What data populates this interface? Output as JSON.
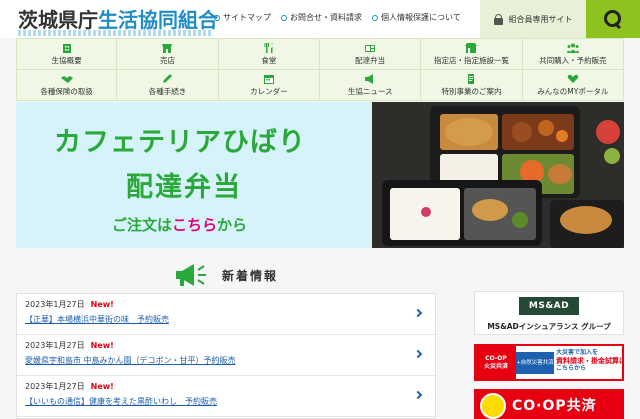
{
  "header": {
    "logo_main": "茨城県庁",
    "logo_accent": "生活協同組合",
    "links": [
      "サイトマップ",
      "お問合せ・資料請求",
      "個人情報保護について"
    ],
    "member_site": "組合員専用サイト"
  },
  "nav": {
    "items": [
      {
        "label": "生協概要",
        "icon": "building-icon"
      },
      {
        "label": "売店",
        "icon": "shop-icon"
      },
      {
        "label": "食堂",
        "icon": "cutlery-icon"
      },
      {
        "label": "配達弁当",
        "icon": "bento-icon"
      },
      {
        "label": "指定店・指定施設一覧",
        "icon": "store-icon"
      },
      {
        "label": "共同購入・予約販売",
        "icon": "people-icon"
      },
      {
        "label": "各種保険の取扱",
        "icon": "handshake-icon"
      },
      {
        "label": "各種手続き",
        "icon": "pen-icon"
      },
      {
        "label": "カレンダー",
        "icon": "calendar-icon"
      },
      {
        "label": "生協ニュース",
        "icon": "megaphone-icon"
      },
      {
        "label": "特別事業のご案内",
        "icon": "document-icon"
      },
      {
        "label": "みんなのMYポータル",
        "icon": "heart-icon"
      }
    ]
  },
  "hero": {
    "title": "カフェテリアひばり",
    "subtitle": "配達弁当",
    "order_prefix": "ご注文は",
    "order_highlight": "こちら",
    "order_suffix": "から"
  },
  "news": {
    "title": "新着情報",
    "new_label": "New!",
    "items": [
      {
        "date": "2023年1月27日",
        "text": "【正華】本場横浜中華街の味　予約販売"
      },
      {
        "date": "2023年1月27日",
        "text": "愛媛県宇和島市 中島みかん園（デコポン・甘平）予約販売"
      },
      {
        "date": "2023年1月27日",
        "text": "【いいもの通信】健康を考えた黒酢いわし　予約販売"
      }
    ]
  },
  "ads": {
    "msad_logo": "MS&AD",
    "msad_text": "MS&ADインシュアランス グループ",
    "kasai_left": [
      "CO-OP",
      "火災共済"
    ],
    "kasai_plus": "+自然災害共済",
    "kasai_right": [
      "大災害で加入を",
      "資料請求・掛金試算は",
      "こちらから"
    ],
    "kyosai": "CO·OP共済"
  },
  "colors": {
    "accent_blue": "#1f8cc7",
    "brand_green": "#8dc21f",
    "hero_green": "#2aa83a",
    "new_red": "#e60012",
    "link_blue": "#1f5fb0"
  }
}
